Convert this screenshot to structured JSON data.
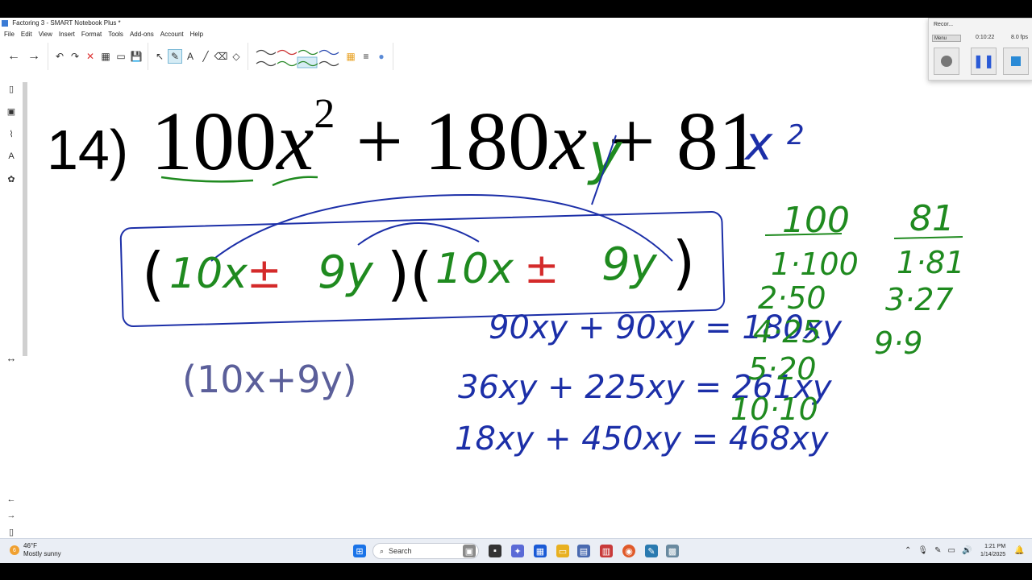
{
  "window": {
    "title": "Factoring 3 - SMART Notebook Plus *"
  },
  "menu": [
    "File",
    "Edit",
    "View",
    "Insert",
    "Format",
    "Tools",
    "Add-ons",
    "Account",
    "Help"
  ],
  "toolbar_icons": {
    "back": "←",
    "forward": "→",
    "undo": "↶",
    "redo": "↷",
    "delete": "✕",
    "table": "▦",
    "screen": "▭",
    "save": "💾",
    "pointer": "↖",
    "pen": "✎",
    "eraser": "⌫",
    "text": "A",
    "line": "╱",
    "shapes": "◇"
  },
  "problem": {
    "number": "14)",
    "t1_coef": "100",
    "t1_var": "x",
    "t1_exp": "2",
    "op1": "+",
    "t2_coef": "180",
    "t2_var": "x",
    "op2": "+",
    "t3_coef": "81",
    "t3_var": "y",
    "t3_exp": "2"
  },
  "handwriting": {
    "factor_open": "(",
    "f1": "10x",
    "pm1": "±",
    "g1": "9y",
    "close_open": ")(",
    "f2": "10x",
    "pm2": "±",
    "g2": "9y",
    "factor_close": ")",
    "gray": "(10x+9y)",
    "pair_100_header": "100",
    "pair_100": [
      "1·100",
      "2·50",
      "4·25",
      "5·20",
      "10·10"
    ],
    "pair_81_header": "81",
    "pair_81": [
      "1·81",
      "3·27",
      "9·9"
    ],
    "sums": [
      "90xy + 90xy = 180xy",
      "36xy + 225xy = 261xy",
      "18xy + 450xy = 468xy"
    ]
  },
  "recorder": {
    "title": "Recor...",
    "menu": "Menu",
    "time": "0:10:22",
    "fps": "8.0 fps"
  },
  "taskbar": {
    "temp": "46°F",
    "condition": "Mostly sunny",
    "badge": "6",
    "search_placeholder": "Search",
    "time": "1:21 PM",
    "date": "1/14/2025"
  },
  "colors": {
    "ink_blue": "#1c2fa8",
    "ink_green": "#1f8a1f",
    "ink_red": "#d42a2a"
  }
}
